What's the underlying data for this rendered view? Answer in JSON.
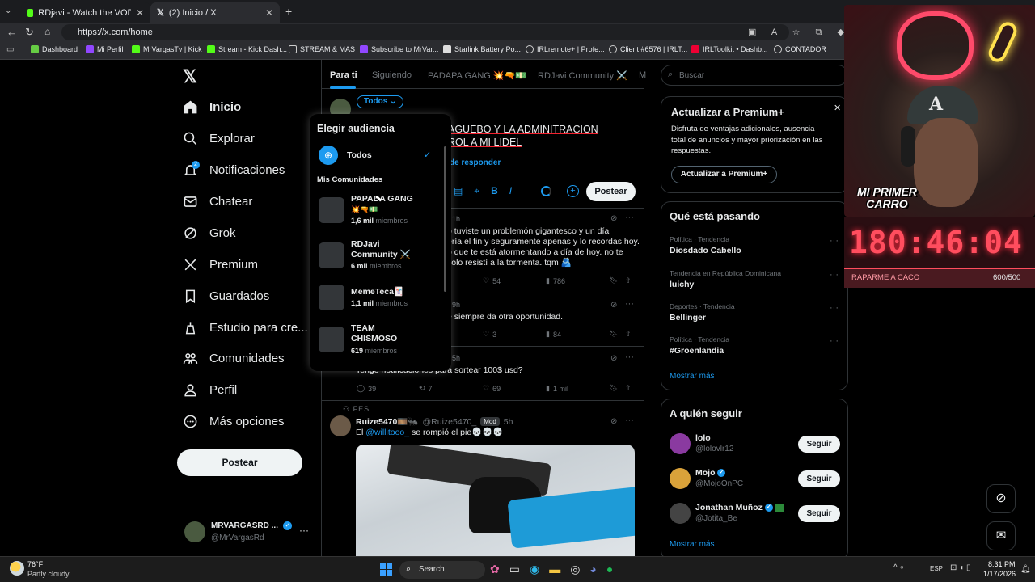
{
  "browser": {
    "tabs": [
      {
        "title": "RDjavi - Watch the VOD on Kick",
        "active": false
      },
      {
        "title": "(2) Inicio / X",
        "active": true
      }
    ],
    "url": "https://x.com/home",
    "bookmarks": [
      "Dashboard",
      "Mi Perfil",
      "MrVargasTv | Kick",
      "Stream - Kick Dash...",
      "STREAM & MAS",
      "Subscribe to MrVar...",
      "Starlink Battery Po...",
      "IRLremote+ | Profe...",
      "Client #6576 | IRLT...",
      "IRLToolkit • Dashb...",
      "CONTADOR"
    ]
  },
  "sidebar": {
    "items": [
      {
        "label": "Inicio",
        "icon": "home-icon"
      },
      {
        "label": "Explorar",
        "icon": "search-icon"
      },
      {
        "label": "Notificaciones",
        "icon": "bell-icon",
        "badge": "2"
      },
      {
        "label": "Chatear",
        "icon": "mail-icon"
      },
      {
        "label": "Grok",
        "icon": "grok-icon"
      },
      {
        "label": "Premium",
        "icon": "x-icon"
      },
      {
        "label": "Guardados",
        "icon": "bookmark-icon"
      },
      {
        "label": "Estudio para cre...",
        "icon": "studio-icon"
      },
      {
        "label": "Comunidades",
        "icon": "communities-icon"
      },
      {
        "label": "Perfil",
        "icon": "person-icon"
      },
      {
        "label": "Más opciones",
        "icon": "more-icon"
      }
    ],
    "post_button": "Postear",
    "account": {
      "name": "MRVARGASRD ...",
      "handle": "@MrVargasRd"
    }
  },
  "feed": {
    "tabs": [
      "Para ti",
      "Siguiendo",
      "PADAPA GANG 💥🔫💵",
      "RDJavi Community ⚔️",
      "M"
    ],
    "composer": {
      "audience": "Todos",
      "text_line1": "AGUEBO Y LA ADMINITRACION",
      "text_line2": "ROL A MI LIDEL",
      "reply_setting": "de responder",
      "post_button": "Postear"
    },
    "posts": [
      {
        "time": "1h",
        "lines": [
          "o tuviste un problemón gigantesco y un día",
          "ería el fin y seguramente apenas y lo recordas hoy.",
          "o que te está atormentando a día de hoy. no te",
          "solo resistí a la tormenta. tqm 🫂"
        ],
        "likes": "54",
        "views": "786"
      },
      {
        "time": "9h",
        "lines": [
          "e siempre da otra oportunidad."
        ],
        "likes": "3",
        "views": "84"
      },
      {
        "time": "5h",
        "lines": [
          "Tengo notificaciones para sortear 100$ usd?"
        ],
        "replies": "39",
        "reposts": "7",
        "likes": "69",
        "views": "1 mil"
      },
      {
        "context": "FES",
        "name": "Ruize5470🎞️🐜",
        "handle": "@Ruize5470_",
        "badge": "Mod",
        "time": "5h",
        "text_prefix": "El",
        "mention": "@willitooo_",
        "text_suffix": "se rompió el pie💀💀💀"
      }
    ]
  },
  "audience_dropdown": {
    "title": "Elegir audiencia",
    "selected": "Todos",
    "section": "Mis Comunidades",
    "communities": [
      {
        "name": "PAPADA GANG",
        "emoji": "💥🔫💵",
        "members_count": "1,6 mil",
        "members_label": "miembros"
      },
      {
        "name": "RDJavi",
        "name2": "Community ⚔️",
        "members_count": "6 mil",
        "members_label": "miembros"
      },
      {
        "name": "MemeTeca🃏",
        "members_count": "1,1 mil",
        "members_label": "miembros"
      },
      {
        "name": "TEAM",
        "name2": "CHISMOSO",
        "members_count": "619",
        "members_label": "miembros"
      }
    ]
  },
  "right": {
    "search_placeholder": "Buscar",
    "premium": {
      "title": "Actualizar a Premium+",
      "desc1": "Disfruta de ventajas adicionales, ausencia",
      "desc2": "total de anuncios y mayor priorización en las",
      "desc3": "respuestas.",
      "button": "Actualizar a Premium+"
    },
    "trends_title": "Qué está pasando",
    "trends": [
      {
        "category": "Política · Tendencia",
        "name": "Diosdado Cabello"
      },
      {
        "category": "Tendencia en República Dominicana",
        "name": "luichy"
      },
      {
        "category": "Deportes · Tendencia",
        "name": "Bellinger"
      },
      {
        "category": "Política · Tendencia",
        "name": "#Groenlandia"
      }
    ],
    "show_more": "Mostrar más",
    "who_title": "A quién seguir",
    "who": [
      {
        "name": "lolo",
        "handle": "@lolovlr12",
        "button": "Seguir"
      },
      {
        "name": "Mojo",
        "handle": "@MojoOnPC",
        "button": "Seguir"
      },
      {
        "name": "Jonathan Muñoz",
        "handle": "@Jotita_Be",
        "button": "Seguir"
      }
    ],
    "who_more": "Mostrar más"
  },
  "stream_overlay": {
    "cap_line1": "MI PRIMER",
    "cap_line2": "CARRO",
    "timer": "180:46:04",
    "goal_label": "RAPARME A CACO",
    "goal_count": "600/500"
  },
  "taskbar": {
    "weather_temp": "76°F",
    "weather_desc": "Partly cloudy",
    "search": "Search",
    "lang": "ESP",
    "time": "8:31 PM",
    "date": "1/17/2026"
  }
}
